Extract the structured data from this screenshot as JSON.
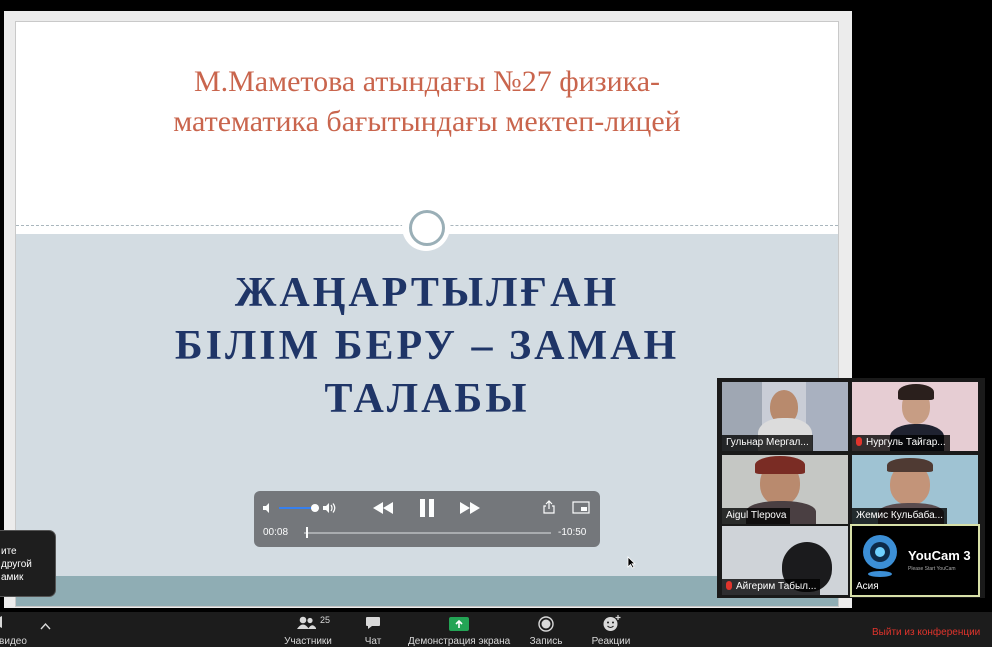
{
  "slide": {
    "title_line1": "М.Маметова атындағы №27 физика-",
    "title_line2": "математика бағытындағы мектеп-лицей",
    "heading_line1": "ЖАҢАРТЫЛҒАН",
    "heading_line2": "БІЛІМ БЕРУ – ЗАМАН",
    "heading_line3": "ТАЛАБЫ"
  },
  "player": {
    "elapsed": "00:08",
    "remaining": "-10:50",
    "progress_fraction": 0.01,
    "volume_fraction": 0.9
  },
  "tooltip": {
    "line1": "ите",
    "line2": "другой",
    "line3": "амик"
  },
  "participants": [
    {
      "name": "Гульнар Мергал...",
      "muted": false
    },
    {
      "name": "Нургуль Тайгар...",
      "muted": true
    },
    {
      "name": "Aigul Tlepova",
      "muted": false
    },
    {
      "name": "Жемис Кульбаба...",
      "muted": false
    },
    {
      "name": "Айгерим Табыл...",
      "muted": true
    },
    {
      "name": "Асия",
      "muted": false,
      "overlay_brand": "YouCam",
      "overlay_version": "3",
      "overlay_tagline": "Please Start YouCam"
    }
  ],
  "toolbar": {
    "video_label": "ь видео",
    "participants_label": "Участники",
    "participants_count": "25",
    "chat_label": "Чат",
    "share_label": "Демонстрация экрана",
    "record_label": "Запись",
    "reactions_label": "Реакции",
    "leave_label": "Выйти из конференции"
  },
  "colors": {
    "slide_title": "#c9654d",
    "slide_heading": "#1f3567",
    "slide_band": "#d3dce2",
    "slide_footer": "#8fadb4",
    "leave": "#e0342c",
    "share_green": "#23a455",
    "active_speaker_border": "#d8e0a8"
  }
}
